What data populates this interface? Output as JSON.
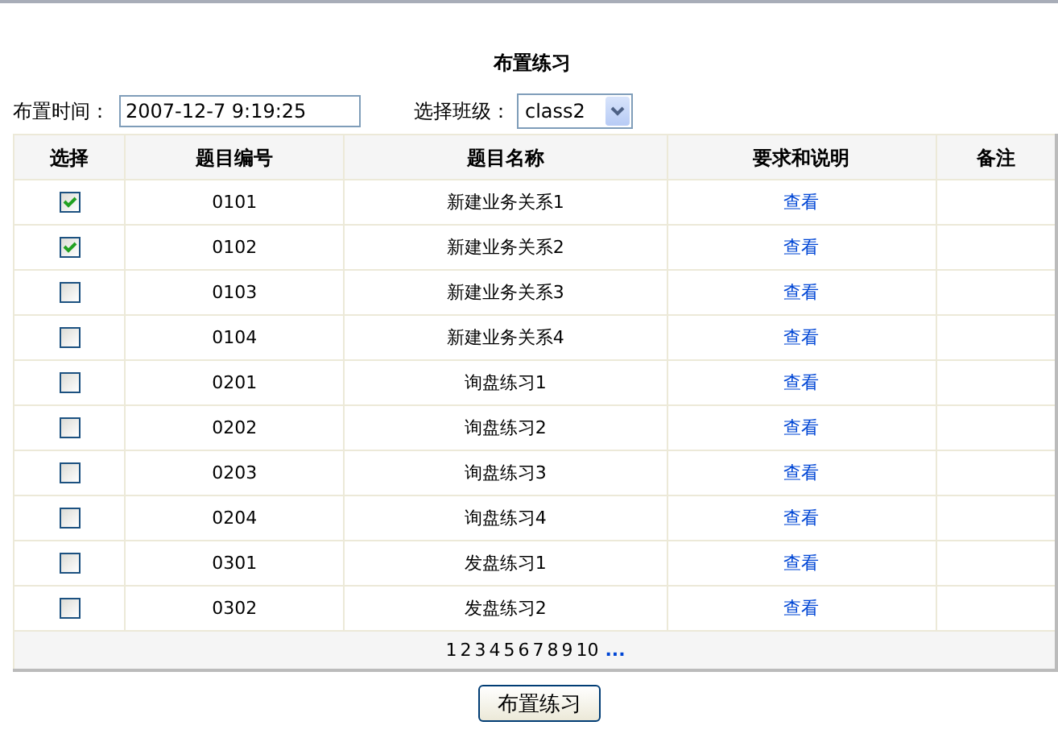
{
  "title": "布置练习",
  "form": {
    "time_label": "布置时间：",
    "time_value": "2007-12-7 9:19:25",
    "class_label": "选择班级：",
    "class_value": "class2"
  },
  "table": {
    "columns": [
      "选择",
      "题目编号",
      "题目名称",
      "要求和说明",
      "备注"
    ],
    "rows": [
      {
        "checked": true,
        "number": "0101",
        "name": "新建业务关系1",
        "link": "查看"
      },
      {
        "checked": true,
        "number": "0102",
        "name": "新建业务关系2",
        "link": "查看"
      },
      {
        "checked": false,
        "number": "0103",
        "name": "新建业务关系3",
        "link": "查看"
      },
      {
        "checked": false,
        "number": "0104",
        "name": "新建业务关系4",
        "link": "查看"
      },
      {
        "checked": false,
        "number": "0201",
        "name": "询盘练习1",
        "link": "查看"
      },
      {
        "checked": false,
        "number": "0202",
        "name": "询盘练习2",
        "link": "查看"
      },
      {
        "checked": false,
        "number": "0203",
        "name": "询盘练习3",
        "link": "查看"
      },
      {
        "checked": false,
        "number": "0204",
        "name": "询盘练习4",
        "link": "查看"
      },
      {
        "checked": false,
        "number": "0301",
        "name": "发盘练习1",
        "link": "查看"
      },
      {
        "checked": false,
        "number": "0302",
        "name": "发盘练习2",
        "link": "查看"
      }
    ]
  },
  "pager": {
    "pages": [
      "1",
      "2",
      "3",
      "4",
      "5",
      "6",
      "7",
      "8",
      "9",
      "10"
    ],
    "more": "..."
  },
  "submit_button": "布置练习"
}
